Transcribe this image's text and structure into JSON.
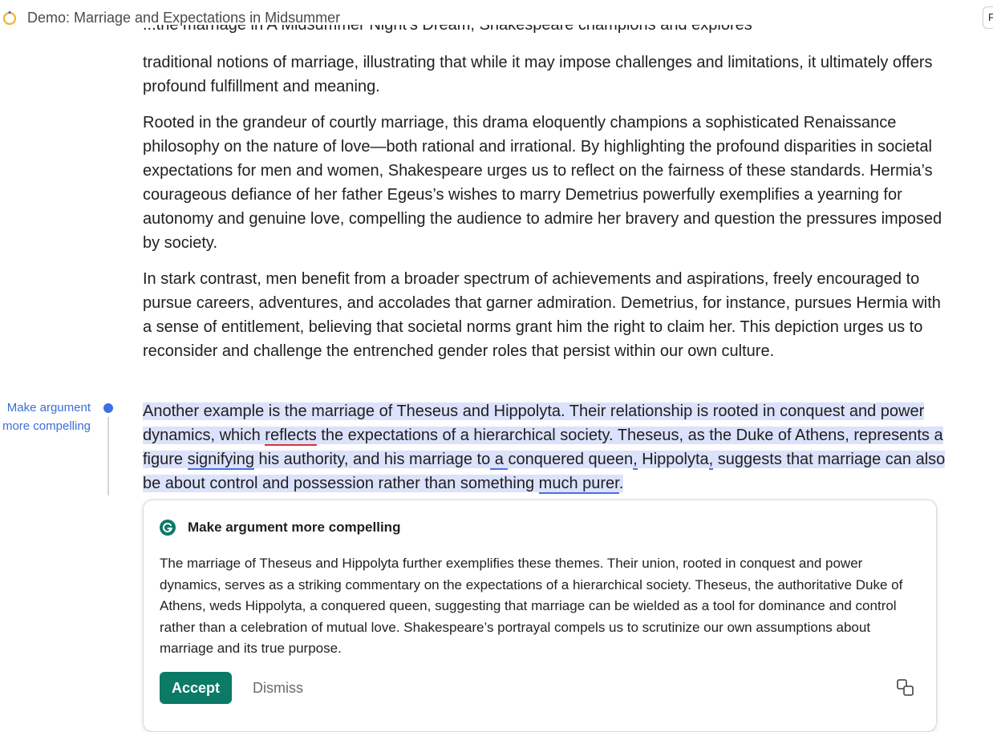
{
  "header": {
    "title": "Demo: Marriage and Expectations in Midsummer",
    "corner_label": "F"
  },
  "document": {
    "clipped_top_line": "...the marriage in A Midsummer Night's Dream, Shakespeare champions and explores",
    "para1": "traditional notions of marriage, illustrating that while it may impose challenges and limitations, it ultimately offers profound fulfillment and meaning.",
    "para2": "Rooted in the grandeur of courtly marriage, this drama eloquently champions a sophisticated Renaissance philosophy on the nature of love—both rational and irrational. By highlighting the profound disparities in societal expectations for men and women, Shakespeare urges us to reflect on the fairness of these standards. Hermia’s courageous defiance of her father Egeus’s wishes to marry Demetrius powerfully exemplifies a yearning for autonomy and genuine love, compelling the audience to admire her bravery and question the pressures imposed by society.",
    "para3": "In stark contrast, men benefit from a broader spectrum of achievements and aspirations, freely encouraged to pursue careers, adventures, and accolades that garner admiration. Demetrius, for instance, pursues Hermia with a sense of entitlement, believing that societal norms grant him the right to claim her. This depiction urges us to reconsider and challenge the entrenched gender roles that persist within our own culture.",
    "para4": {
      "s1": "Another example is the marriage of Theseus and Hippolyta. Their relationship is rooted in conquest and power dynamics, which ",
      "w_reflects": "reflects",
      "s2": " the expectations of a hierarchical society. Theseus, as the Duke of Athens, represents a figure ",
      "w_signifying": "signifying",
      "s3": " his authority, and his marriage to",
      "w_a": " a ",
      "s4": "conquered queen",
      "w_comma1": ",",
      "s5": " Hippolyta",
      "w_comma2": ",",
      "s6": " suggests that marriage can also be about control and possession rather than something ",
      "w_purer": "much purer",
      "s7": "."
    }
  },
  "suggestion": {
    "side_label": "Make argument more compelling",
    "title": "Make argument more compelling",
    "text": "The marriage of Theseus and Hippolyta further exemplifies these themes. Their union, rooted in conquest and power dynamics, serves as a striking commentary on the expectations of a hierarchical society. Theseus, the authoritative Duke of Athens, weds Hippolyta, a conquered queen, suggesting that marriage can be wielded as a tool for dominance and control rather than a celebration of mutual love. Shakespeare’s portrayal compels us to scrutinize our own assumptions about marriage and its true purpose.",
    "accept_label": "Accept",
    "dismiss_label": "Dismiss",
    "icons": {
      "brand": "grammarly-g-icon",
      "copy": "copy-icon"
    }
  },
  "colors": {
    "accent": "#0b7a66",
    "highlight": "#dbe2fb",
    "link_blue": "#3b6fd8",
    "error_red": "#d9363e"
  }
}
